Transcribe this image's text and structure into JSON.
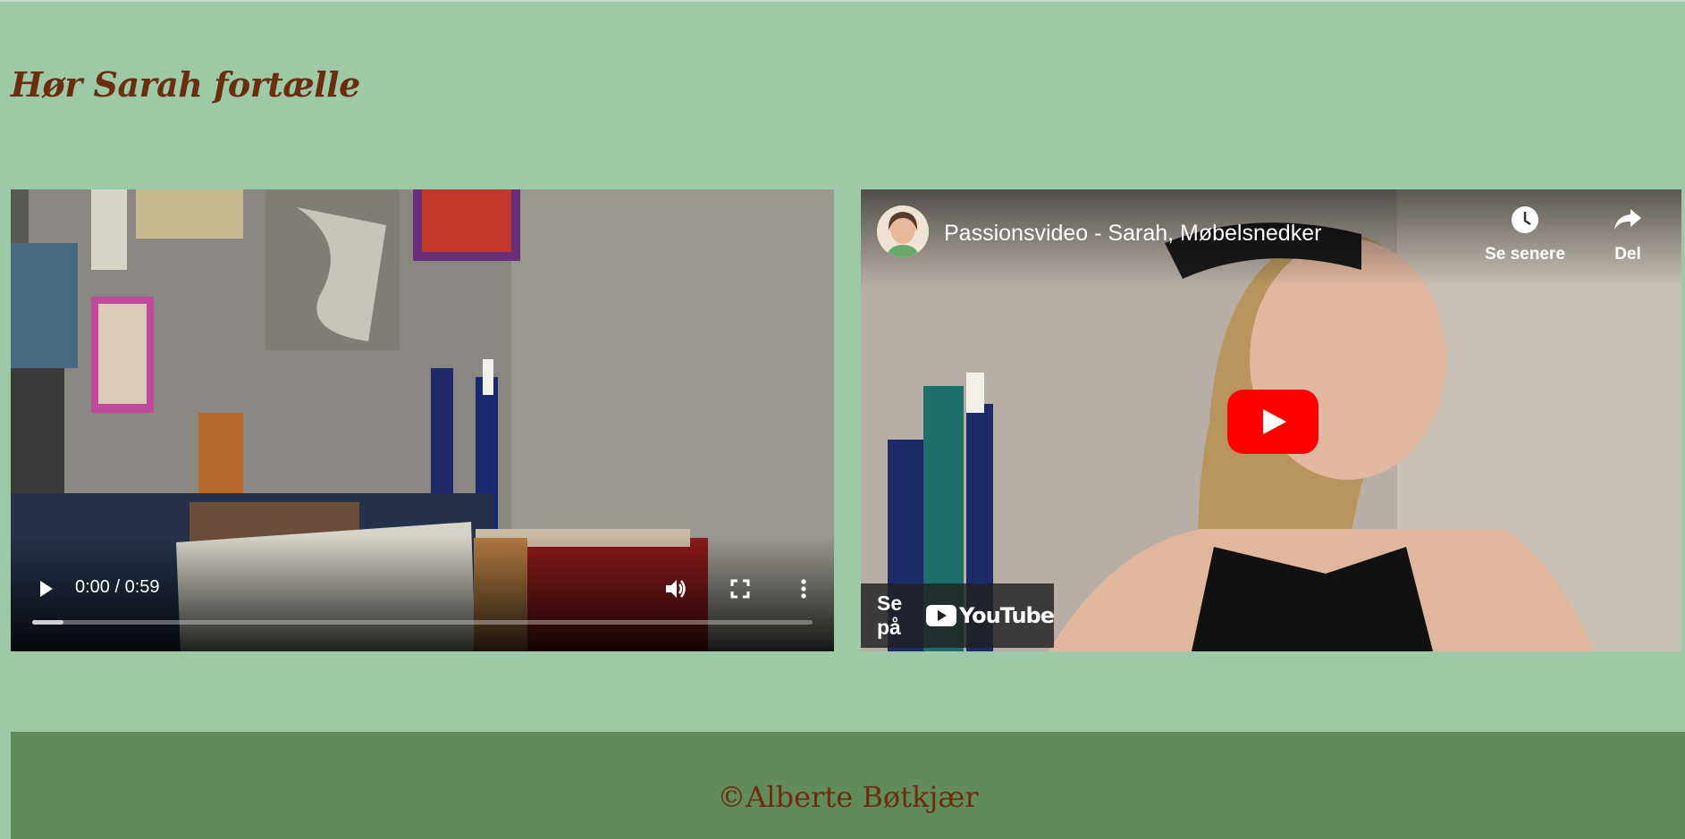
{
  "page": {
    "title": "Hør Sarah fortælle",
    "colors": {
      "background": "#9dc9a6",
      "title": "#6b2d0c",
      "footer_bg": "#628b5c"
    }
  },
  "video_player": {
    "time": "0:00 / 0:59",
    "progress_fraction": 0.04,
    "icons": [
      "play-icon",
      "volume-icon",
      "fullscreen-icon",
      "more-options-icon"
    ]
  },
  "youtube_embed": {
    "title": "Passionsvideo - Sarah, Møbelsnedker",
    "watch_later_label": "Se senere",
    "share_label": "Del",
    "watch_on_label": "Se på",
    "logo_text": "YouTube",
    "play_button_color": "#ff0000"
  },
  "footer": {
    "text": "©Alberte Bøtkjær"
  }
}
